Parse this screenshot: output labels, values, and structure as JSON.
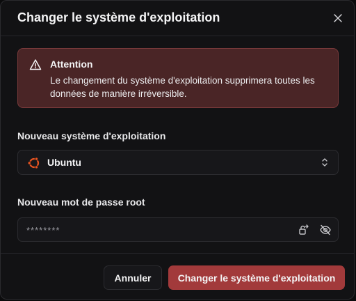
{
  "dialog": {
    "title": "Changer le système d'exploitation",
    "close_icon": "close-icon"
  },
  "warning": {
    "icon": "warning-triangle-icon",
    "title": "Attention",
    "text": "Le changement du système d'exploitation supprimera toutes les données de manière irréversible."
  },
  "os_select": {
    "label": "Nouveau système d'exploitation",
    "selected": "Ubuntu",
    "icon": "ubuntu-logo-icon",
    "chevron_icon": "chevron-up-down-icon"
  },
  "password": {
    "label": "Nouveau mot de passe root",
    "value": "********",
    "generate_icon": "key-generate-icon",
    "toggle_visibility_icon": "eye-off-icon"
  },
  "actions": {
    "cancel_label": "Annuler",
    "confirm_label": "Changer le système d'exploitation"
  },
  "colors": {
    "accent": "#a23a3b",
    "warning_bg": "#4a2526",
    "ubuntu": "#e95420"
  }
}
